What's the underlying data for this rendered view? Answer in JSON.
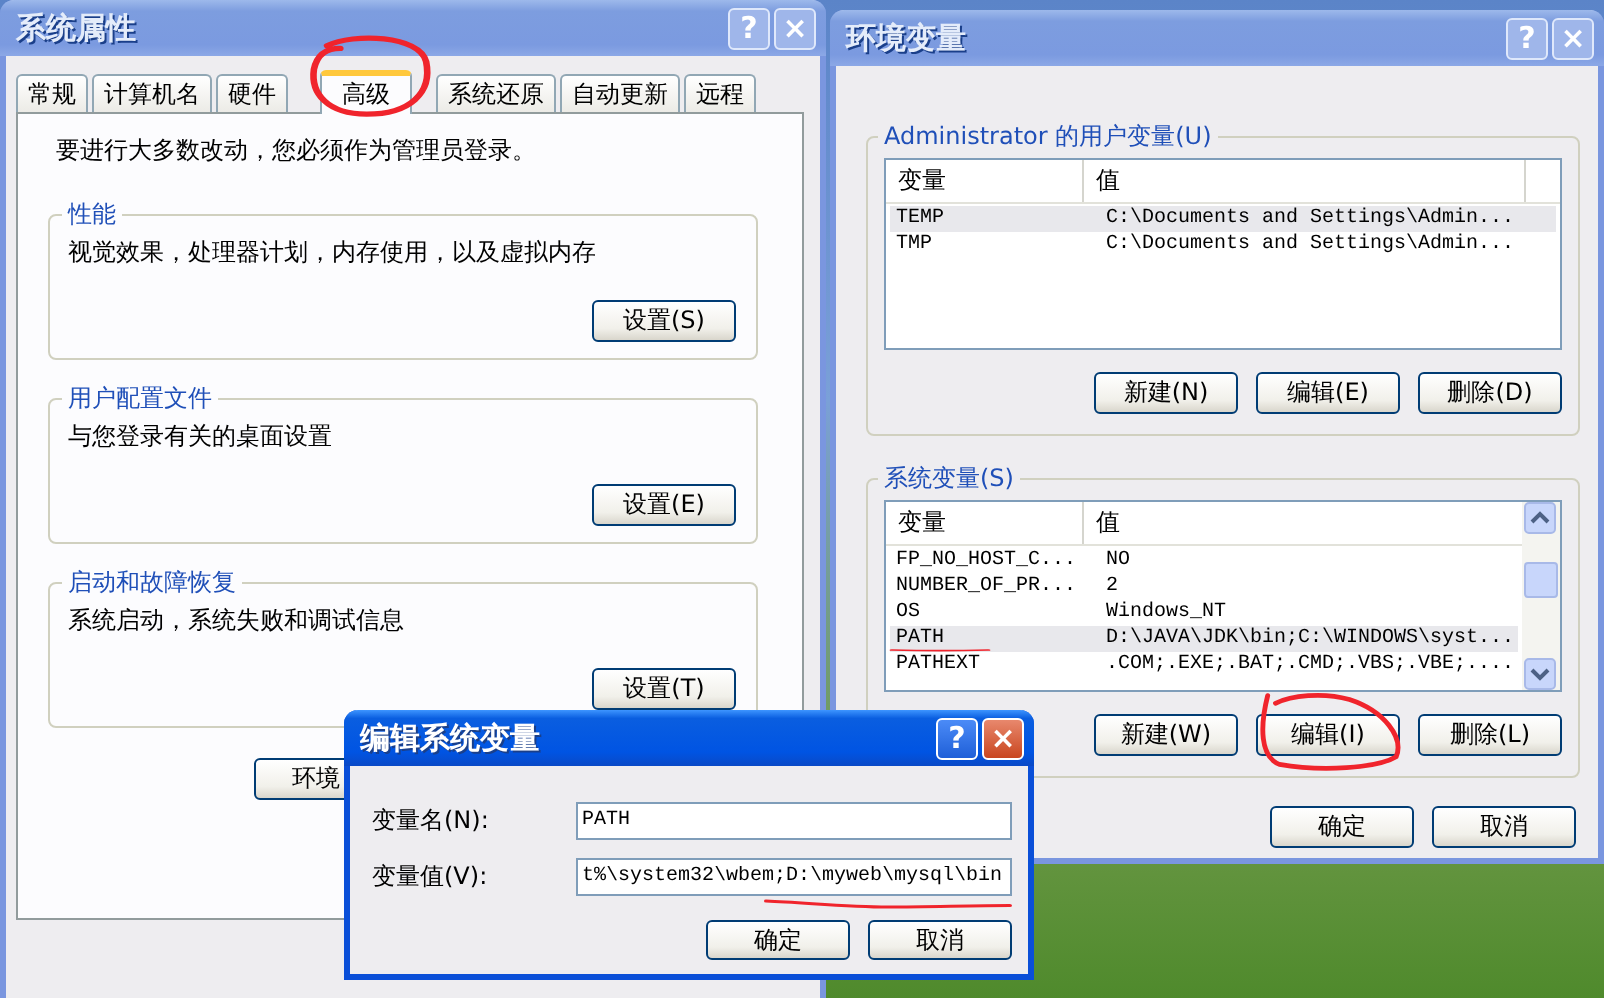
{
  "system_properties": {
    "title": "系统属性",
    "active": false,
    "title_buttons": [
      "?",
      "×"
    ],
    "tabs": [
      {
        "label": "常规",
        "selected": false,
        "circled": false
      },
      {
        "label": "计算机名",
        "selected": false,
        "circled": false
      },
      {
        "label": "硬件",
        "selected": false,
        "circled": false
      },
      {
        "label": "高级",
        "selected": true,
        "circled": true
      },
      {
        "label": "系统还原",
        "selected": false,
        "circled": false
      },
      {
        "label": "自动更新",
        "selected": false,
        "circled": false
      },
      {
        "label": "远程",
        "selected": false,
        "circled": false
      }
    ],
    "notice": "要进行大多数改动，您必须作为管理员登录。",
    "groups": [
      {
        "title": "性能",
        "description": "视觉效果，处理器计划，内存使用，以及虚拟内存",
        "button": "设置(S)"
      },
      {
        "title": "用户配置文件",
        "description": "与您登录有关的桌面设置",
        "button": "设置(E)"
      },
      {
        "title": "启动和故障恢复",
        "description": "系统启动，系统失败和调试信息",
        "button": "设置(T)"
      }
    ],
    "env_button": "环境"
  },
  "environment_variables": {
    "title": "环境变量",
    "active": false,
    "title_buttons": [
      "?",
      "×"
    ],
    "sections": [
      {
        "title": "Administrator 的用户变量(U)",
        "columns": [
          "变量",
          "值"
        ],
        "scrollbar": false,
        "rows": [
          {
            "name": "TEMP",
            "value": "C:\\Documents and Settings\\Admin...",
            "selected": true,
            "underlined": false
          },
          {
            "name": "TMP",
            "value": "C:\\Documents and Settings\\Admin...",
            "selected": false,
            "underlined": false
          }
        ],
        "buttons": [
          {
            "label": "新建(N)",
            "circled": false
          },
          {
            "label": "编辑(E)",
            "circled": false
          },
          {
            "label": "删除(D)",
            "circled": false
          }
        ]
      },
      {
        "title": "系统变量(S)",
        "columns": [
          "变量",
          "值"
        ],
        "scrollbar": true,
        "rows": [
          {
            "name": "FP_NO_HOST_C...",
            "value": "NO",
            "selected": false,
            "underlined": false
          },
          {
            "name": "NUMBER_OF_PR...",
            "value": "2",
            "selected": false,
            "underlined": false
          },
          {
            "name": "OS",
            "value": "Windows_NT",
            "selected": false,
            "underlined": false
          },
          {
            "name": "PATH",
            "value": "D:\\JAVA\\JDK\\bin;C:\\WINDOWS\\syst...",
            "selected": true,
            "underlined": true
          },
          {
            "name": "PATHEXT",
            "value": ".COM;.EXE;.BAT;.CMD;.VBS;.VBE;....",
            "selected": false,
            "underlined": false
          }
        ],
        "buttons": [
          {
            "label": "新建(W)",
            "circled": false
          },
          {
            "label": "编辑(I)",
            "circled": true
          },
          {
            "label": "删除(L)",
            "circled": false
          }
        ]
      }
    ],
    "buttons": [
      "确定",
      "取消"
    ]
  },
  "edit_variable": {
    "title": "编辑系统变量",
    "active": true,
    "title_buttons": [
      "?",
      "×"
    ],
    "fields": [
      {
        "label": "变量名(N):",
        "value": "PATH",
        "underlined": false
      },
      {
        "label": "变量值(V):",
        "value": "t%\\system32\\wbem;D:\\myweb\\mysql\\bin",
        "underlined": true
      }
    ],
    "buttons": [
      "确定",
      "取消"
    ]
  }
}
